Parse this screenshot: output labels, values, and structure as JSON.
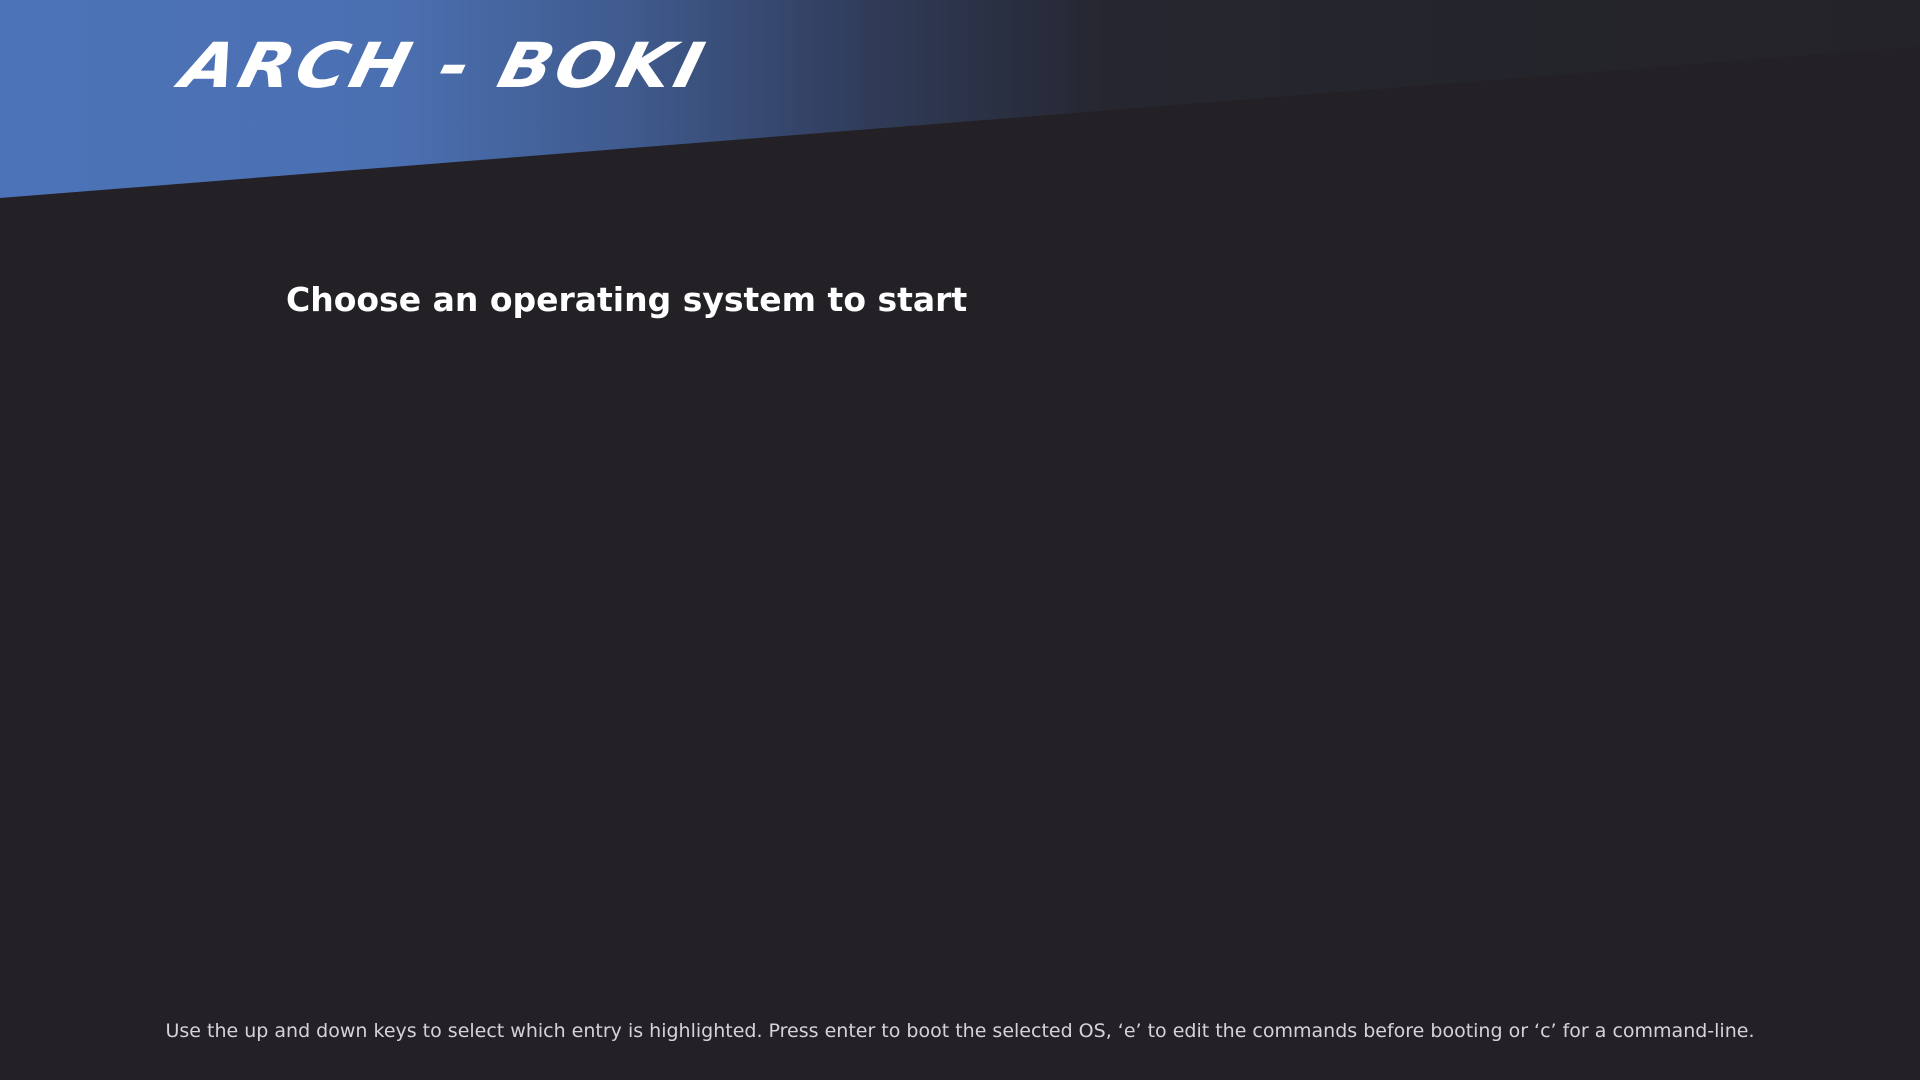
{
  "theme": {
    "background": "#232125",
    "accent": "#4c73b8"
  },
  "header": {
    "logo_text": "ARCH - BOKI"
  },
  "main": {
    "title": "Choose an operating system to start",
    "entries": []
  },
  "footer": {
    "help_text": "Use the up and down keys to select which entry is highlighted. Press enter to boot the selected OS, ‘e’ to edit the commands before booting or ‘c’ for a command-line."
  }
}
